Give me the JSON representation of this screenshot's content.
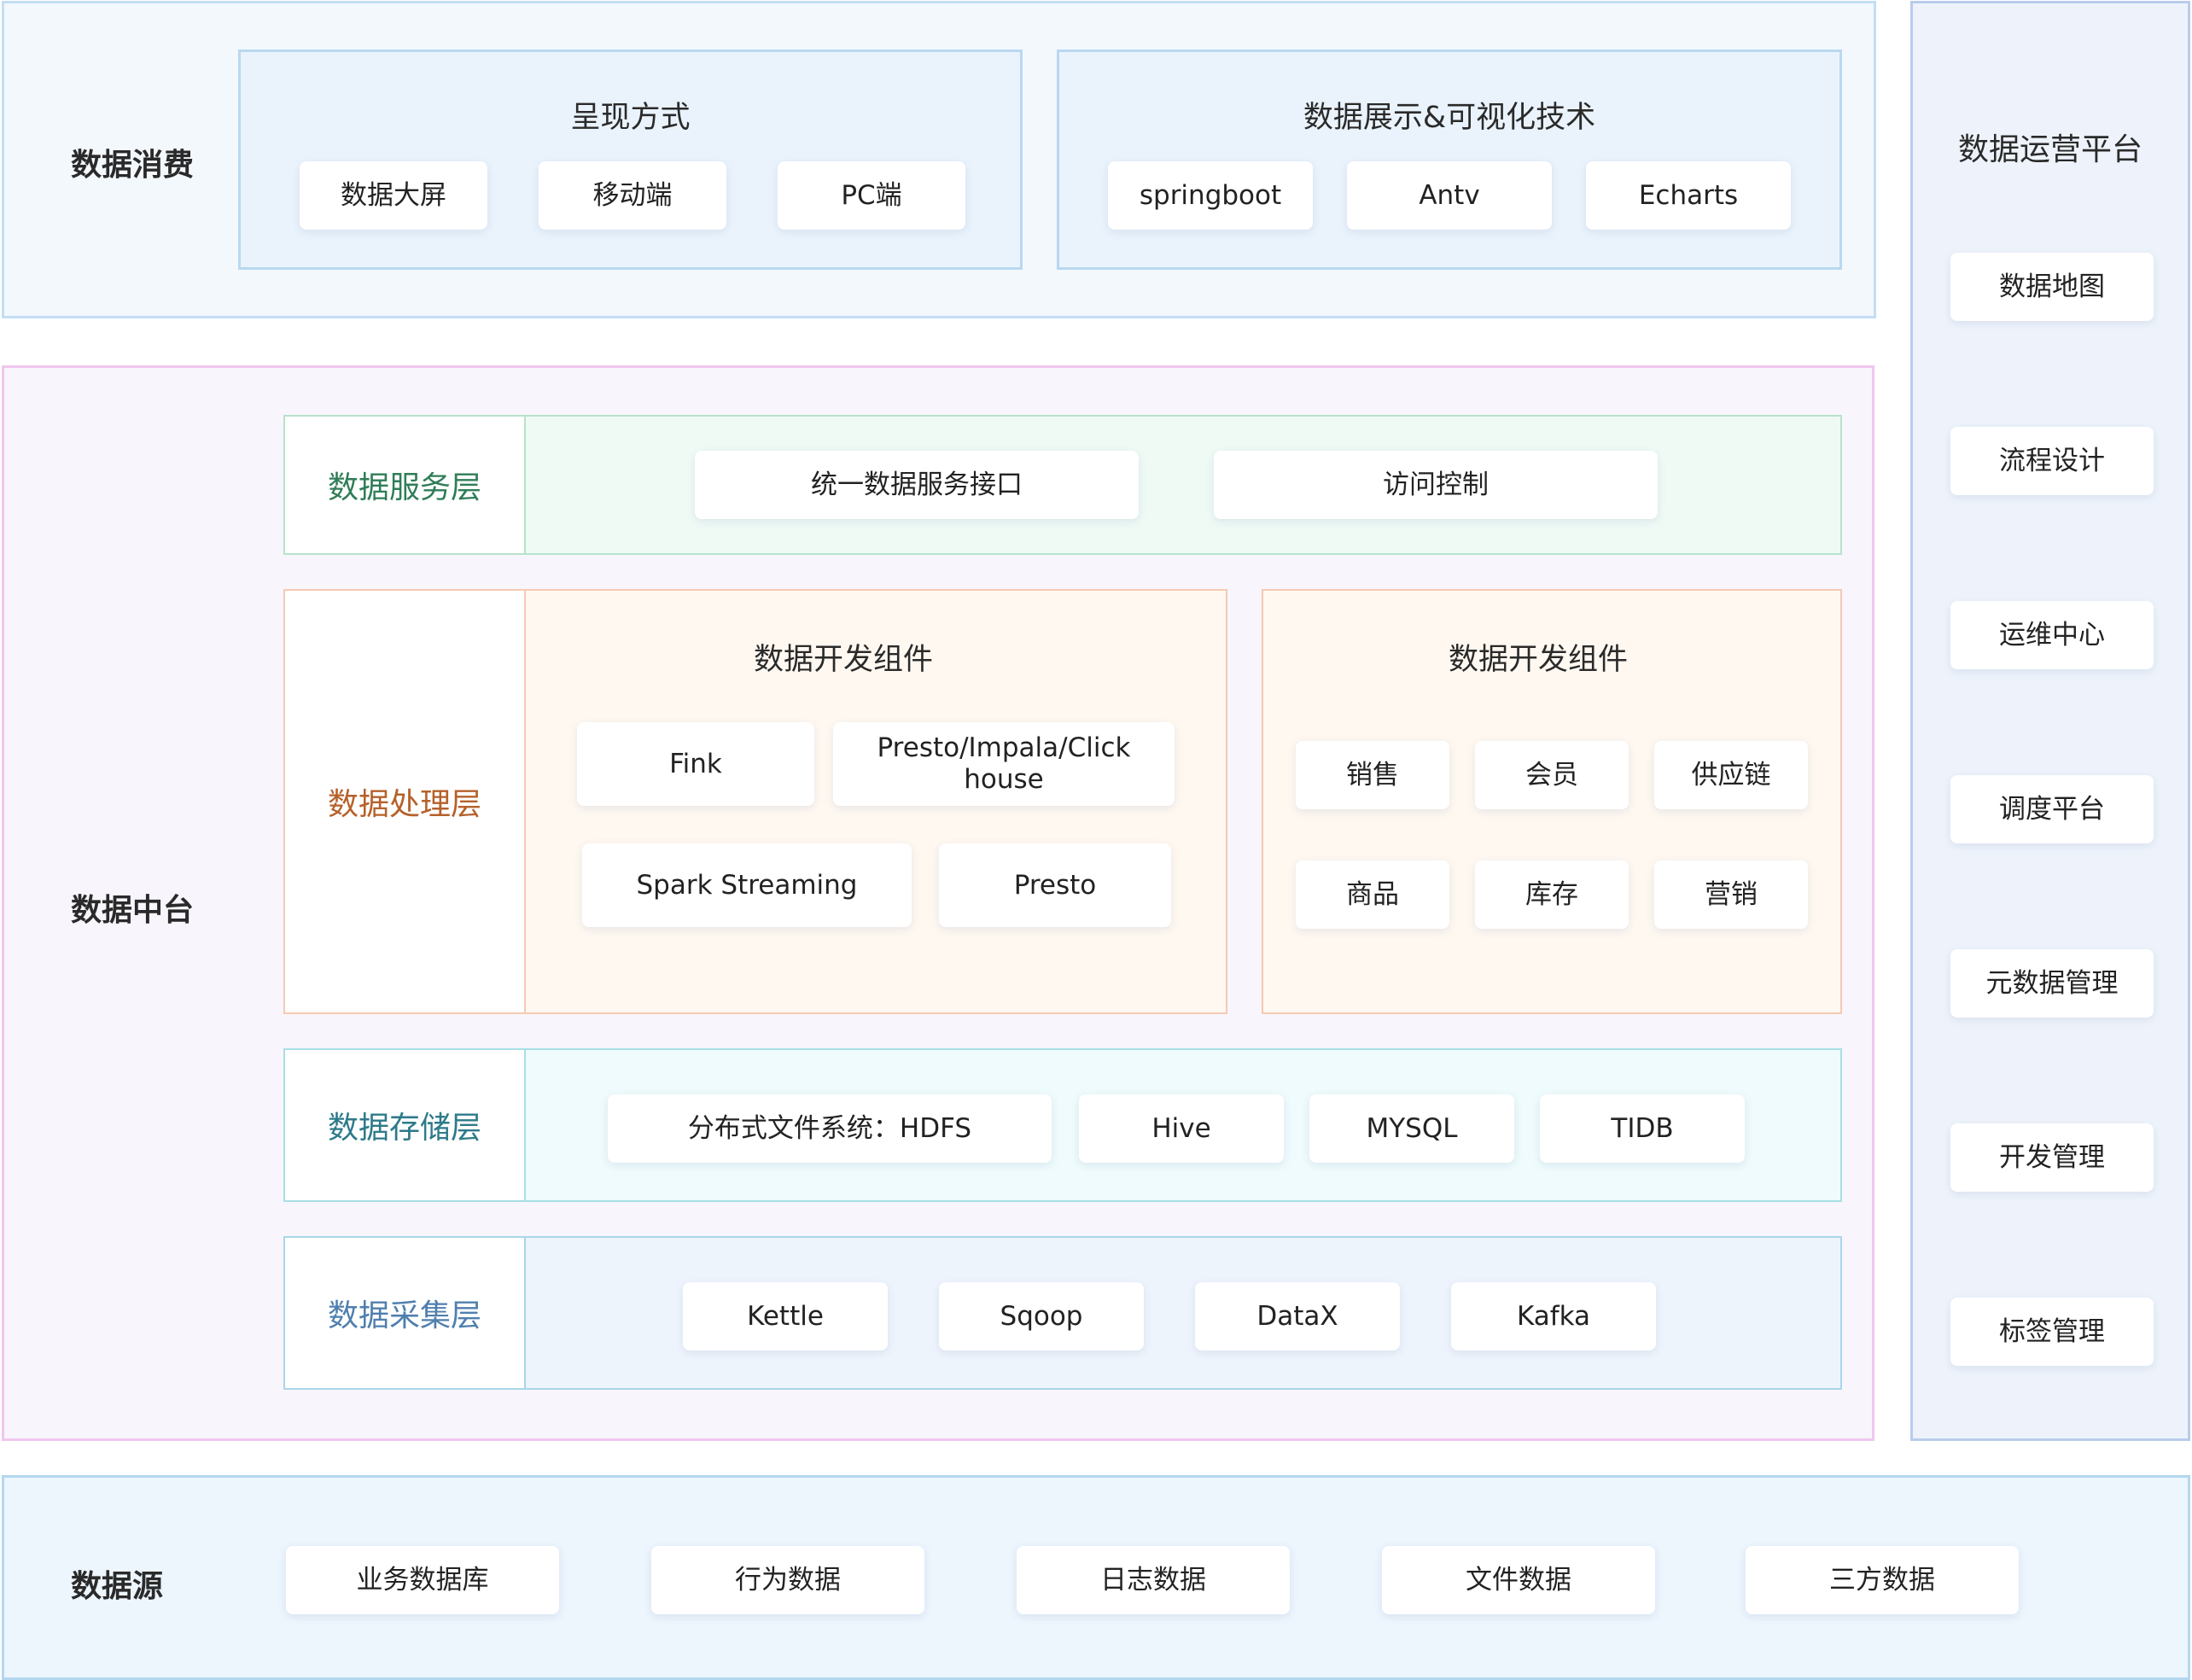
{
  "consumption": {
    "title": "数据消费",
    "presentation": {
      "title": "呈现方式",
      "items": [
        "数据大屏",
        "移动端",
        "PC端"
      ]
    },
    "visualization": {
      "title": "数据展示&可视化技术",
      "items": [
        "springboot",
        "Antv",
        "Echarts"
      ]
    }
  },
  "middle_platform": {
    "title": "数据中台",
    "service_layer": {
      "label": "数据服务层",
      "items": [
        "统一数据服务接口",
        "访问控制"
      ]
    },
    "processing_layer": {
      "label": "数据处理层",
      "dev_components": {
        "title": "数据开发组件",
        "items": [
          "Fink",
          "Presto/Impala/Click house",
          "Spark Streaming",
          "Presto"
        ]
      },
      "domain_components": {
        "title": "数据开发组件",
        "items": [
          "销售",
          "会员",
          "供应链",
          "商品",
          "库存",
          "营销"
        ]
      }
    },
    "storage_layer": {
      "label": "数据存储层",
      "items": [
        "分布式文件系统：HDFS",
        "Hive",
        "MYSQL",
        "TIDB"
      ]
    },
    "collection_layer": {
      "label": "数据采集层",
      "items": [
        "Kettle",
        "Sqoop",
        "DataX",
        "Kafka"
      ]
    }
  },
  "source": {
    "title": "数据源",
    "items": [
      "业务数据库",
      "行为数据",
      "日志数据",
      "文件数据",
      "三方数据"
    ]
  },
  "ops_platform": {
    "title": "数据运营平台",
    "items": [
      "数据地图",
      "流程设计",
      "运维中心",
      "调度平台",
      "元数据管理",
      "开发管理",
      "标签管理"
    ]
  },
  "colors": {
    "service": "#2f7d57",
    "processing": "#b5612a",
    "storage": "#2d7a8a",
    "collection": "#4f7fae"
  }
}
